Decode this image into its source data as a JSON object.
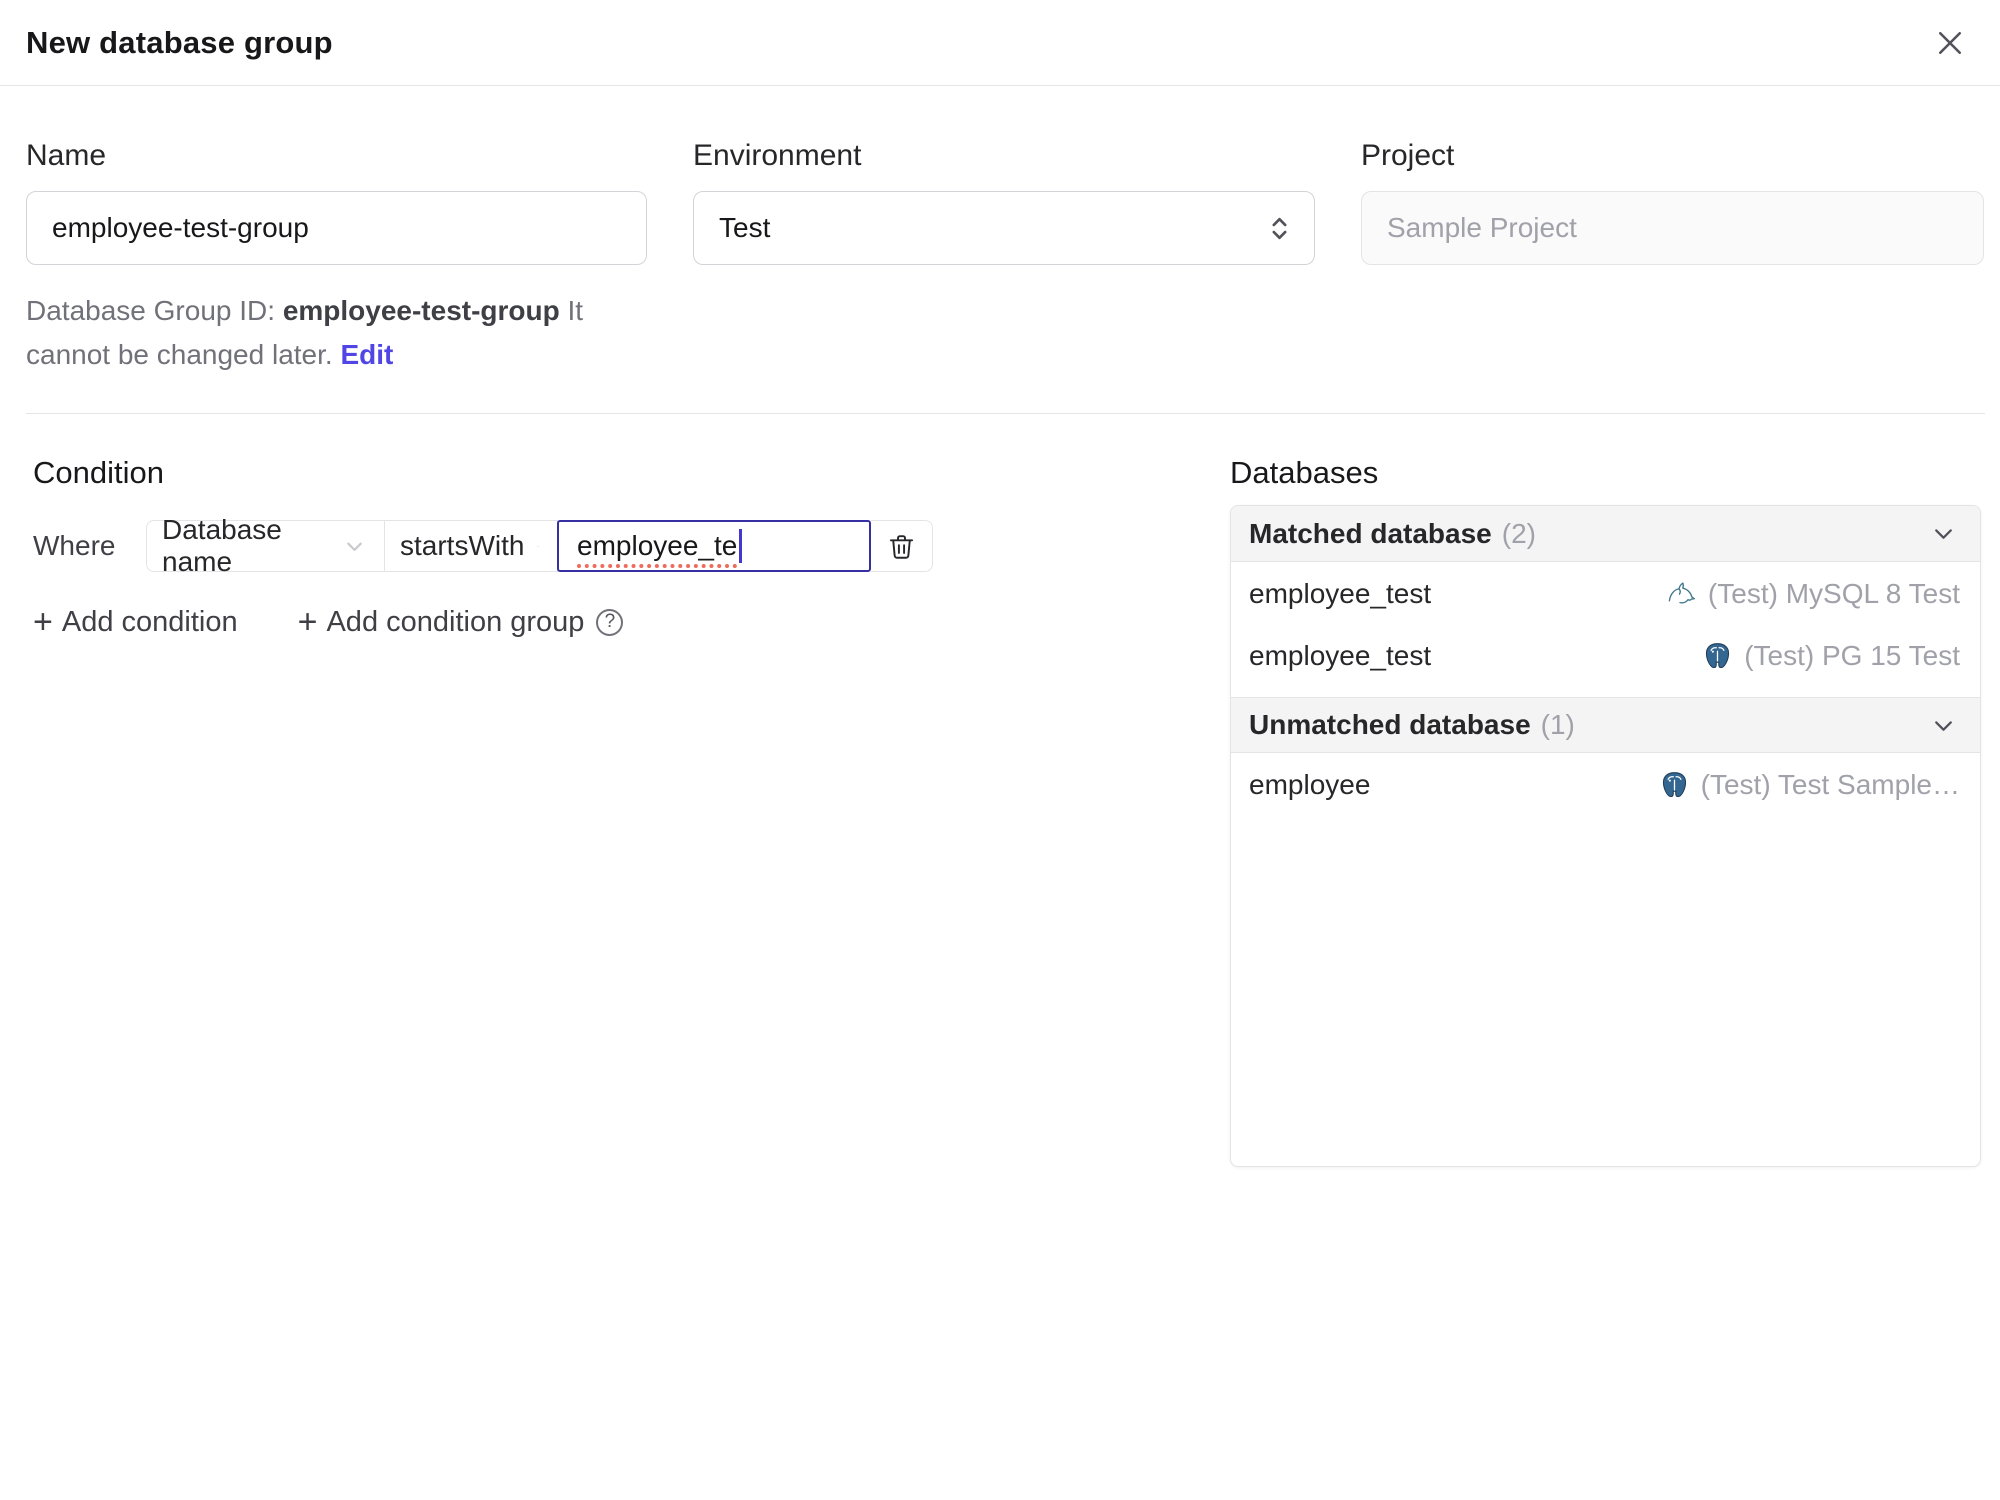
{
  "dialog": {
    "title": "New database group"
  },
  "form": {
    "name": {
      "label": "Name",
      "value": "employee-test-group"
    },
    "environment": {
      "label": "Environment",
      "value": "Test"
    },
    "project": {
      "label": "Project",
      "value": "Sample Project"
    },
    "group_id_note": {
      "prefix": "Database Group ID: ",
      "id": "employee-test-group",
      "suffix": " It cannot be changed later. ",
      "edit_label": "Edit"
    }
  },
  "condition": {
    "heading": "Condition",
    "where_label": "Where",
    "field": "Database name",
    "operator": "startsWith",
    "value": "employee_te",
    "plus_icon": "+",
    "add_condition_label": "Add condition",
    "add_condition_group_label": "Add condition group",
    "help_icon": "?"
  },
  "databases": {
    "heading": "Databases",
    "sections": [
      {
        "title": "Matched database",
        "count": "(2)",
        "rows": [
          {
            "name": "employee_test",
            "engine": "mysql",
            "instance": "(Test) MySQL 8 Test"
          },
          {
            "name": "employee_test",
            "engine": "postgres",
            "instance": "(Test) PG 15 Test"
          }
        ]
      },
      {
        "title": "Unmatched database",
        "count": "(1)",
        "rows": [
          {
            "name": "employee",
            "engine": "postgres",
            "instance": "(Test) Test Sample…"
          }
        ]
      }
    ]
  },
  "colors": {
    "accent": "#4f46e5",
    "focus_border": "#3730a3",
    "mysql_icon": "#40788e",
    "postgres_icon": "#336791"
  }
}
